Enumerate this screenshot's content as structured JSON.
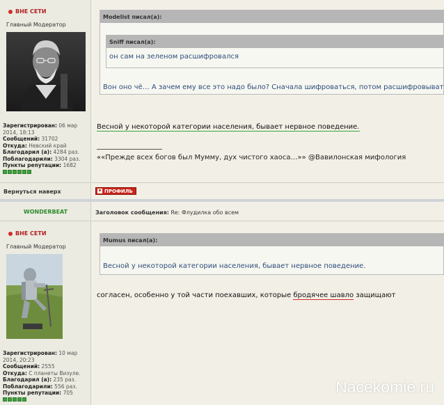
{
  "post1": {
    "status": "ВНЕ СЕТИ",
    "rank": "Главный Модератор",
    "stats": [
      {
        "label": "Зарегистрирован:",
        "value": "06 мар 2014, 18:13"
      },
      {
        "label": "Сообщений:",
        "value": "31702"
      },
      {
        "label": "Откуда:",
        "value": "Невский край"
      },
      {
        "label": "Благодарил (а):",
        "value": "4284 раз."
      },
      {
        "label": "Поблагодарили:",
        "value": "3304 раз."
      },
      {
        "label": "Пункты репутации:",
        "value": "1682"
      }
    ],
    "quote_outer_header": "Modelist писал(а):",
    "quote_inner_header": "Sniff писал(а):",
    "quote_inner_text": "он сам на зеленом расшифровался",
    "quote_outer_text": "Вон оно чё… А зачем ему все это надо было? Сначала шифроваться, потом расшифровываться…",
    "body": "Весной у некоторой категории населения, бывает нервное поведение.",
    "signature": "««Прежде всех богов был Мумму, дух чистого хаоса…»» @Вавилонская мифология",
    "back_to_top": "Вернуться наверх",
    "profile_button": "ПРОФИЛЬ"
  },
  "post2": {
    "username": "WONDERBEAT",
    "subject_label": "Заголовок сообщения:",
    "subject": "Re: Флудилка обо всем",
    "status": "ВНЕ СЕТИ",
    "rank": "Главный Модератор",
    "stats": [
      {
        "label": "Зарегистрирован:",
        "value": "10 мар 2014, 20:23"
      },
      {
        "label": "Сообщений:",
        "value": "2555"
      },
      {
        "label": "Откуда:",
        "value": "С планеты Визуле."
      },
      {
        "label": "Благодарил (а):",
        "value": "235 раз."
      },
      {
        "label": "Поблагодарили:",
        "value": "556 раз."
      },
      {
        "label": "Пункты репутации:",
        "value": "705"
      }
    ],
    "quote_header": "Mumus писал(а):",
    "quote_text": "Весной у некоторой категории населения, бывает нервное поведение.",
    "body_before": "согласен, особенно у той части поехавших, которые ",
    "body_underlined": "бродячее шавло",
    "body_after": " защищают"
  },
  "watermark": "Nacekomie.ru",
  "colors": {
    "background": "#f2f0e6",
    "left_panel": "#ecebe1",
    "quote_header": "#b6b6b6",
    "quote_text": "#2c4d7a",
    "offline": "#d42a2a",
    "username": "#2e8b2e",
    "profile_button": "#c8261c",
    "reputation": "#3fa23f",
    "divider": "#cfd3d8"
  }
}
